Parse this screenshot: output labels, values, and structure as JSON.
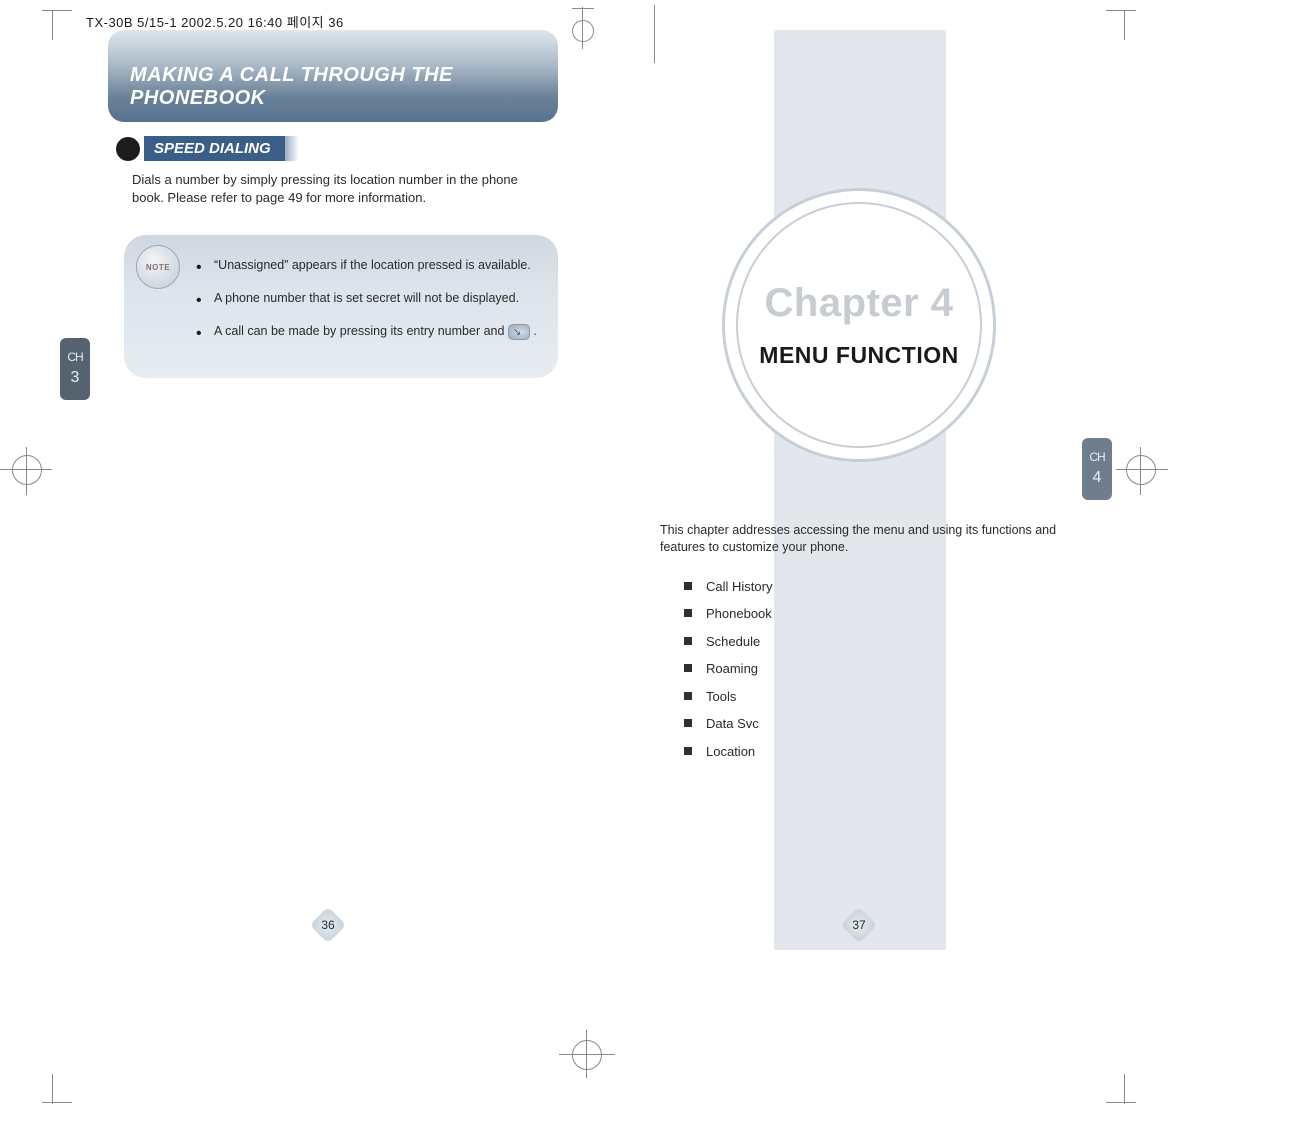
{
  "header_meta": "TX-30B 5/15-1  2002.5.20 16:40 페이지 36",
  "left_page": {
    "title": "MAKING A CALL THROUGH THE PHONEBOOK",
    "subheading": "SPEED DIALING",
    "body": "Dials a number by simply pressing its location number in the phone book. Please refer to page 49 for more information.",
    "note_icon_label": "NOTE",
    "notes": {
      "n1": "“Unassigned” appears if the location pressed is available.",
      "n2": "A phone number that is set secret will not be displayed.",
      "n3_prefix": "A call can be made by pressing its entry number and ",
      "n3_suffix": " ."
    },
    "tab": {
      "ch": "CH",
      "num": "3"
    },
    "page_number": "36"
  },
  "right_page": {
    "chapter_title": "Chapter 4",
    "section_title": "MENU FUNCTION",
    "intro": "This chapter addresses accessing the menu and using its functions and features to customize your phone.",
    "features": {
      "f1": "Call History",
      "f2": "Phonebook",
      "f3": "Schedule",
      "f4": "Roaming",
      "f5": "Tools",
      "f6": "Data Svc",
      "f7": "Location"
    },
    "tab": {
      "ch": "CH",
      "num": "4"
    },
    "page_number": "37"
  }
}
